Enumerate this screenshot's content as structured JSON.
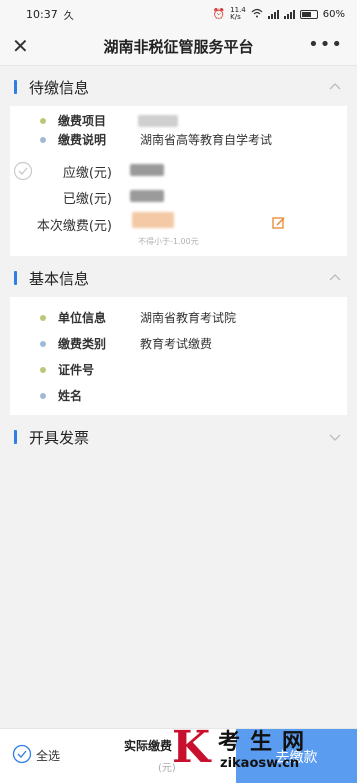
{
  "status": {
    "time": "10:37",
    "carrier_glyph": "久",
    "net_speed": "11.4\nK/s",
    "battery": "60%"
  },
  "appbar": {
    "title": "湖南非税征管服务平台"
  },
  "pending": {
    "title": "待缴信息",
    "item_label": "缴费项目",
    "desc_label": "缴费说明",
    "desc_value": "湖南省高等教育自学考试",
    "due_label": "应缴(元)",
    "paid_label": "已缴(元)",
    "this_label": "本次缴费(元)",
    "hint": "不得小于-1.00元"
  },
  "basic": {
    "title": "基本信息",
    "unit_label": "单位信息",
    "unit_value": "湖南省教育考试院",
    "type_label": "缴费类别",
    "type_value": "教育考试缴费",
    "id_label": "证件号",
    "name_label": "姓名"
  },
  "invoice": {
    "title": "开具发票"
  },
  "bottom": {
    "select_all": "全选",
    "actual": "实际缴费",
    "actual_sub": "(元)",
    "pay_button": "去缴款"
  },
  "watermark": {
    "text": "考生网",
    "url": "zikaosw.cn"
  },
  "colors": {
    "accent": "#2f7ee8",
    "edit": "#e8892f",
    "pay_button": "#5a9cf0"
  },
  "icons": [
    "close-icon",
    "more-icon",
    "chevron-up-icon",
    "chevron-down-icon",
    "check-circle-icon",
    "edit-icon",
    "wifi-icon",
    "signal-icon",
    "battery-icon"
  ]
}
